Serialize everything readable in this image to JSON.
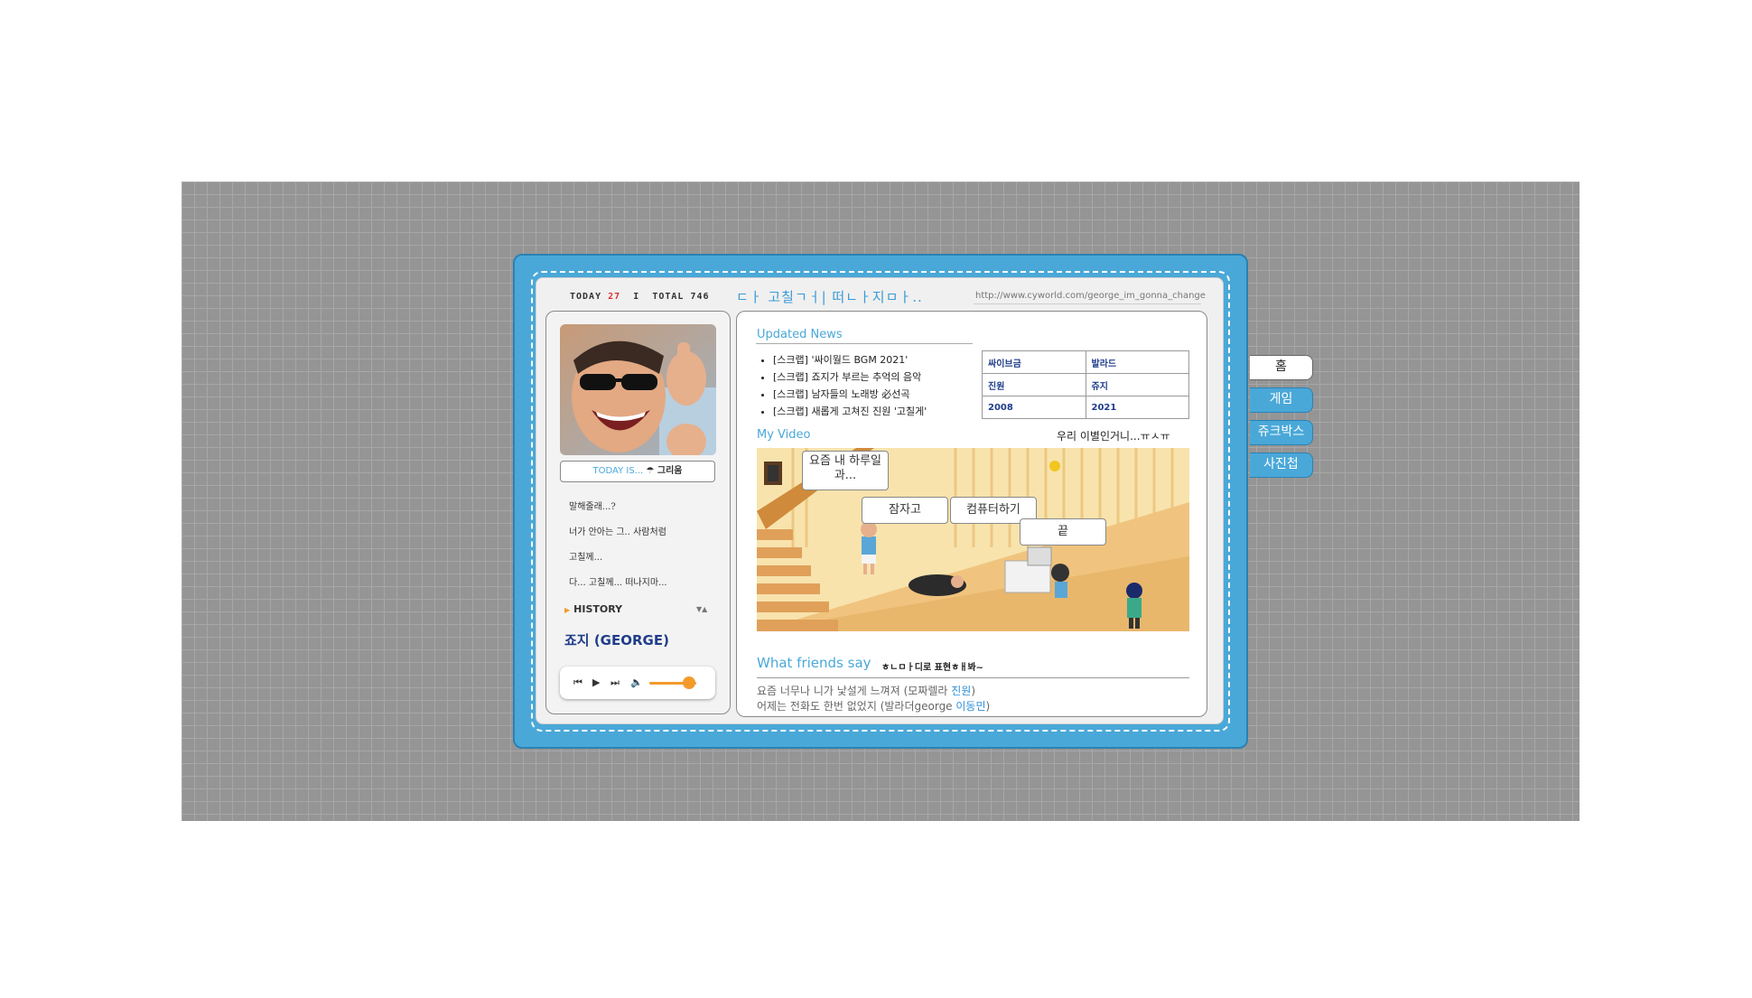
{
  "counter": {
    "today_label": "TODAY",
    "today_value": "27",
    "separator": "I",
    "total_label": "TOTAL",
    "total_value": "746"
  },
  "header": {
    "title": "ㄷㅏ 고칠ㄱㅓ| 떠ㄴㅏ지ㅁㅏ..",
    "url": "http://www.cyworld.com/george_im_gonna_change"
  },
  "profile": {
    "today_is_label": "TODAY IS...",
    "mood": "☂ 그리움",
    "diary_lines": [
      "말해줄래...?",
      "너가 안아는 그.. 사람처럼",
      "고칠께...",
      "다... 고칠께... 떠나지마..."
    ],
    "history_label": "HISTORY",
    "name": "죠지 (GEORGE)"
  },
  "news": {
    "title": "Updated News",
    "items": [
      "[스크랩] '싸이월드 BGM 2021'",
      "[스크랩] 죠지가 부르는 추억의 음악",
      "[스크랩] 남자들의 노래방 必선곡",
      "[스크랩] 새롭게 고쳐진 진원 '고칠게'"
    ]
  },
  "info_table": [
    [
      "싸이브금",
      "발라드"
    ],
    [
      "진원",
      "쥬지"
    ],
    [
      "2008",
      "2021"
    ]
  ],
  "video": {
    "title": "My Video",
    "caption": "우리 이별인거니...ㅠㅅㅠ",
    "bubbles": [
      "요즘 내 하루일과...",
      "잠자고",
      "컴퓨터하기",
      "끝"
    ]
  },
  "friends": {
    "title": "What friends say",
    "subtitle": "ㅎㄴㅁㅏ디로 표현ㅎㅐ봐~",
    "comments": [
      {
        "text": "요즘 너무나 니가 낯설게 느껴져 (모짜렐라 ",
        "who": "진원",
        "end": ")"
      },
      {
        "text": "어제는 전화도 한번 없었지 (발라더george ",
        "who": "이동민",
        "end": ")"
      }
    ]
  },
  "tabs": [
    "홈",
    "게임",
    "쥬크박스",
    "사진첩"
  ],
  "player": {
    "volume": 0.85
  },
  "colors": {
    "frame": "#4aa8d8",
    "accent": "#f39a2b",
    "name": "#1f3d8a",
    "link": "#2f8fd8"
  }
}
